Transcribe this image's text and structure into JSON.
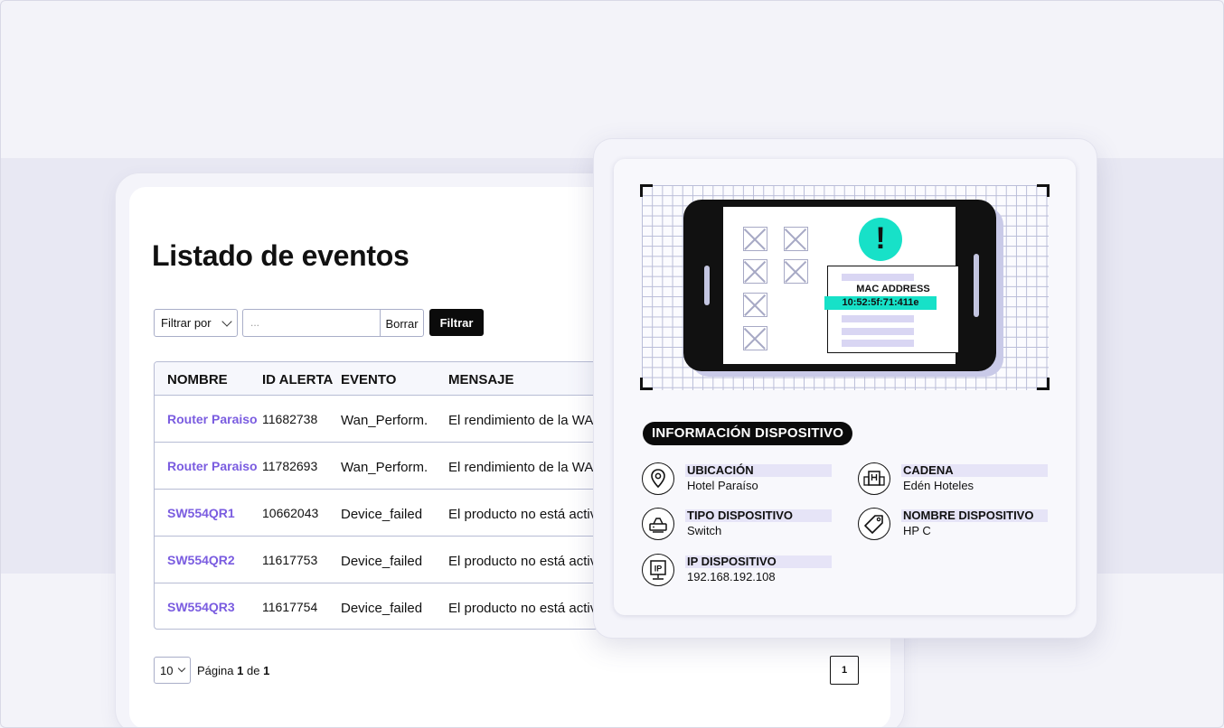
{
  "page": {
    "title": "Listado de eventos"
  },
  "filters": {
    "filter_by_label": "Filtrar por",
    "search_placeholder": "...",
    "clear_label": "Borrar",
    "filter_label": "Filtrar"
  },
  "table": {
    "headers": [
      "NOMBRE",
      "ID ALERTA",
      "EVENTO",
      "MENSAJE"
    ],
    "rows": [
      {
        "name": "Router Paraiso",
        "id": "11682738",
        "event": "Wan_Perform.",
        "message": "El rendimiento de la WAN"
      },
      {
        "name": "Router Paraiso",
        "id": "11782693",
        "event": "Wan_Perform.",
        "message": "El rendimiento de la WAN"
      },
      {
        "name": "SW554QR1",
        "id": "10662043",
        "event": "Device_failed",
        "message": "El producto no está activo"
      },
      {
        "name": "SW554QR2",
        "id": "11617753",
        "event": "Device_failed",
        "message": "El producto no está activo"
      },
      {
        "name": "SW554QR3",
        "id": "11617754",
        "event": "Device_failed",
        "message": "El producto no está activo"
      }
    ]
  },
  "pager": {
    "page_size": "10",
    "text_prefix": "Página",
    "current": "1",
    "text_mid": "de",
    "total": "1",
    "page_button": "1"
  },
  "device": {
    "alert_icon": "!",
    "mac_title": "MAC ADDRESS",
    "mac_value": "10:52:5f:71:411e",
    "section_label": "INFORMACIÓN DISPOSITIVO",
    "fields": {
      "location": {
        "label": "UBICACIÓN",
        "value": "Hotel Paraíso",
        "icon": "location-pin-icon"
      },
      "chain": {
        "label": "CADENA",
        "value": "Edén Hoteles",
        "icon": "hotel-building-icon"
      },
      "type": {
        "label": "TIPO DISPOSITIVO",
        "value": "Switch",
        "icon": "router-icon"
      },
      "name": {
        "label": "NOMBRE DISPOSITIVO",
        "value": "HP C",
        "icon": "tag-icon"
      },
      "ip": {
        "label": "IP DISPOSITIVO",
        "value": "192.168.192.108",
        "icon": "ip-icon"
      }
    }
  },
  "colors": {
    "accent_link": "#7a5ce0",
    "accent_teal": "#17e1c8",
    "highlight_lavender": "#e6e4f7",
    "primary_button": "#0b0b0b"
  }
}
